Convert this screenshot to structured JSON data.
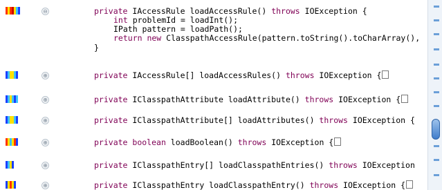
{
  "colors": {
    "keyword": "#7f0055",
    "heat": [
      "#1a3fff",
      "#3cc3ff",
      "#ffe100",
      "#ff3300",
      "#cc0000"
    ]
  },
  "expanded_method": {
    "fold_icon": "collapse-icon",
    "signature_prefix": "private",
    "signature_rest": " IAccessRule loadAccessRule() ",
    "throws_kw": "throws",
    "exception": " IOException {",
    "body": [
      {
        "kw": "int",
        "rest": " problemId = loadInt();"
      },
      {
        "kw": "",
        "rest": "IPath pattern = loadPath();"
      },
      {
        "kw": "return new",
        "rest": " ClasspathAccessRule(pattern.toString().toCharArray(),"
      }
    ],
    "close": "}"
  },
  "collapsed_methods": [
    {
      "fold_icon": "expand-icon",
      "private": "private",
      "rest": " IAccessRule[] loadAccessRules() ",
      "throws": "throws",
      "exception": " IOException {"
    },
    {
      "fold_icon": "expand-icon",
      "private": "private",
      "rest": " IClasspathAttribute loadAttribute() ",
      "throws": "throws",
      "exception": " IOException {"
    },
    {
      "fold_icon": "expand-icon",
      "private": "private",
      "rest": " IClasspathAttribute[] loadAttributes() ",
      "throws": "throws",
      "exception": " IOException {"
    },
    {
      "fold_icon": "expand-icon",
      "private": "private",
      "rest2": "boolean",
      "rest": " loadBoolean() ",
      "throws": "throws",
      "exception": " IOException {"
    },
    {
      "fold_icon": "expand-icon",
      "private": "private",
      "rest": " IClasspathEntry[] loadClasspathEntries() ",
      "throws": "throws",
      "exception": " IOException"
    },
    {
      "fold_icon": "expand-icon",
      "private": "private",
      "rest": " IClasspathEntry loadClasspathEntry() ",
      "throws": "throws",
      "exception": " IOException {"
    }
  ],
  "glyphs": {
    "collapse": "⊖",
    "expand": "⊕"
  }
}
